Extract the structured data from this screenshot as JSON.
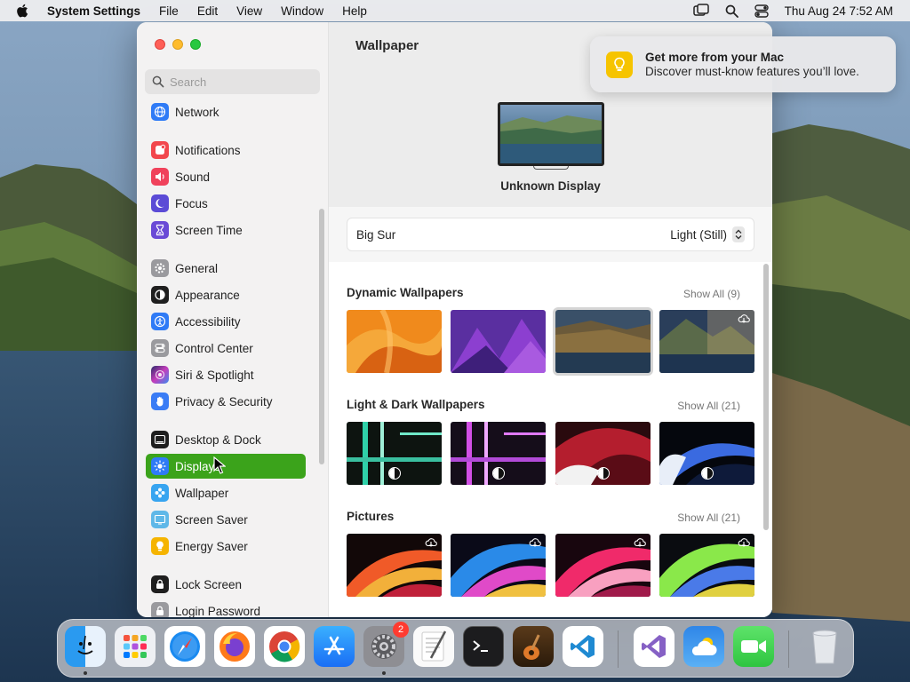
{
  "menubar": {
    "app_name": "System Settings",
    "menus": [
      "File",
      "Edit",
      "View",
      "Window",
      "Help"
    ],
    "datetime": "Thu Aug 24  7:52 AM"
  },
  "search": {
    "placeholder": "Search"
  },
  "sidebar": {
    "items": [
      {
        "label": "Network",
        "icon": "globe-icon",
        "color": "#2f7bf6"
      },
      {
        "label": "Notifications",
        "icon": "bell-icon",
        "color": "#f2474d"
      },
      {
        "label": "Sound",
        "icon": "speaker-icon",
        "color": "#f0425b"
      },
      {
        "label": "Focus",
        "icon": "moon-icon",
        "color": "#5b4bd6"
      },
      {
        "label": "Screen Time",
        "icon": "hourglass-icon",
        "color": "#6a4ad6"
      },
      {
        "label": "General",
        "icon": "gear-icon",
        "color": "#9a9a9e"
      },
      {
        "label": "Appearance",
        "icon": "appearance-icon",
        "color": "#1f1f1f"
      },
      {
        "label": "Accessibility",
        "icon": "accessibility-icon",
        "color": "#2f7bf6"
      },
      {
        "label": "Control Center",
        "icon": "toggles-icon",
        "color": "#9a9a9e"
      },
      {
        "label": "Siri & Spotlight",
        "icon": "siri-icon",
        "color": "#c53dbb"
      },
      {
        "label": "Privacy & Security",
        "icon": "hand-icon",
        "color": "#3a7cf5"
      },
      {
        "label": "Desktop & Dock",
        "icon": "dock-icon",
        "color": "#1f1f1f"
      },
      {
        "label": "Displays",
        "icon": "sun-icon",
        "color": "#2f7bf6"
      },
      {
        "label": "Wallpaper",
        "icon": "flower-icon",
        "color": "#37a4f0"
      },
      {
        "label": "Screen Saver",
        "icon": "screensaver-icon",
        "color": "#5fb8e8"
      },
      {
        "label": "Energy Saver",
        "icon": "bulb-icon",
        "color": "#f5b400"
      },
      {
        "label": "Lock Screen",
        "icon": "lock-icon",
        "color": "#1f1f1f"
      },
      {
        "label": "Login Password",
        "icon": "lock-icon",
        "color": "#9a9a9e"
      }
    ],
    "active_index": 12
  },
  "main": {
    "title": "Wallpaper",
    "display_name": "Unknown Display",
    "current_wallpaper": "Big Sur",
    "mode": "Light (Still)",
    "sections": [
      {
        "title": "Dynamic Wallpapers",
        "show_all": "Show All (9)"
      },
      {
        "title": "Light & Dark Wallpapers",
        "show_all": "Show All (21)"
      },
      {
        "title": "Pictures",
        "show_all": "Show All (21)"
      }
    ]
  },
  "notification": {
    "title": "Get more from your Mac",
    "body": "Discover must-know features you’ll love."
  },
  "dock": {
    "apps": [
      "Finder",
      "Launchpad",
      "Safari",
      "Firefox",
      "Chrome",
      "App Store",
      "System Settings",
      "TextEdit",
      "Terminal",
      "GarageBand",
      "Visual Studio Code",
      "Visual Studio",
      "Weather",
      "FaceTime",
      "Trash"
    ],
    "settings_badge": "2"
  }
}
